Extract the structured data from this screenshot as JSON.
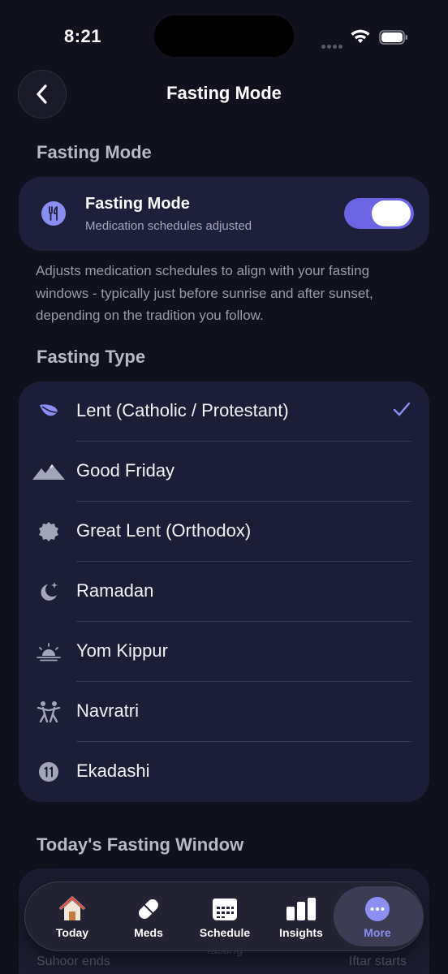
{
  "status_bar": {
    "time": "8:21"
  },
  "header": {
    "title": "Fasting Mode"
  },
  "fasting_mode_section": {
    "label": "Fasting Mode",
    "toggle": {
      "title": "Fasting Mode",
      "subtitle": "Medication schedules adjusted",
      "enabled": true
    },
    "description": "Adjusts medication schedules to align with your fasting windows - typically just before sunrise and after sunset, depending on the tradition you follow."
  },
  "fasting_type_section": {
    "label": "Fasting Type",
    "selected": "Lent (Catholic / Protestant)",
    "options": [
      {
        "label": "Lent (Catholic / Protestant)",
        "icon": "leaf-icon"
      },
      {
        "label": "Good Friday",
        "icon": "mountains-icon"
      },
      {
        "label": "Great Lent (Orthodox)",
        "icon": "seal-icon"
      },
      {
        "label": "Ramadan",
        "icon": "crescent-moon-icon"
      },
      {
        "label": "Yom Kippur",
        "icon": "sunrise-icon"
      },
      {
        "label": "Navratri",
        "icon": "dancing-figures-icon"
      },
      {
        "label": "Ekadashi",
        "icon": "number-11-icon"
      }
    ]
  },
  "fasting_window_section": {
    "label": "Today's Fasting Window",
    "suhoor_label": "Suhoor ends",
    "fasting_label": "fasting",
    "iftar_label": "Iftar starts"
  },
  "tab_bar": {
    "tabs": [
      {
        "label": "Today",
        "icon": "house-icon"
      },
      {
        "label": "Meds",
        "icon": "pill-icon"
      },
      {
        "label": "Schedule",
        "icon": "calendar-icon"
      },
      {
        "label": "Insights",
        "icon": "bar-chart-icon"
      },
      {
        "label": "More",
        "icon": "more-icon"
      }
    ],
    "active": "More"
  },
  "colors": {
    "background": "#11111d",
    "card": "#1c1e38",
    "accent": "#6a64e3",
    "accent_light": "#8b8ff2"
  }
}
